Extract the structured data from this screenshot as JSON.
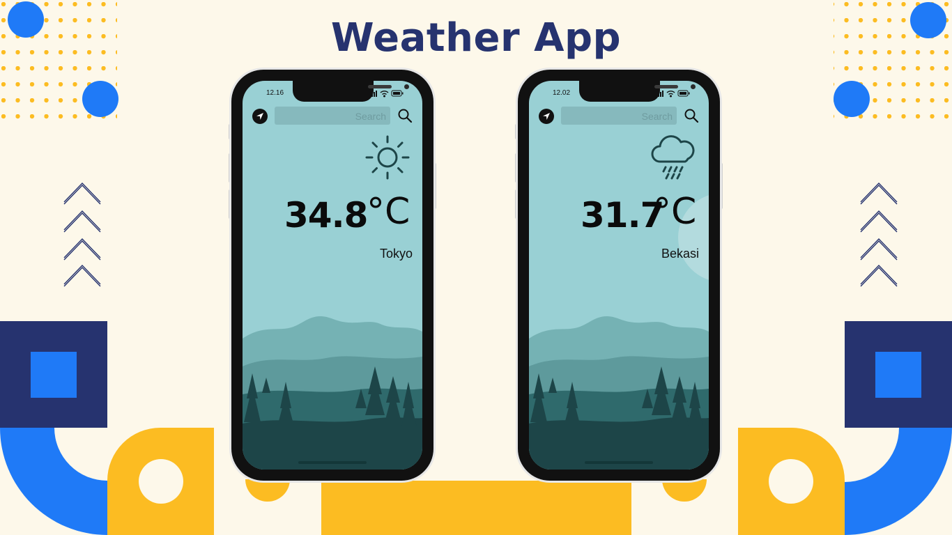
{
  "title": "Weather App",
  "phones": [
    {
      "time": "12.16",
      "search_placeholder": "Search",
      "temperature": "34.8",
      "unit": "°C",
      "city": "Tokyo",
      "condition_icon": "sun-icon"
    },
    {
      "time": "12.02",
      "search_placeholder": "Search",
      "temperature": "31.7",
      "unit": "°C",
      "city": "Bekasi",
      "condition_icon": "rain-cloud-icon"
    }
  ],
  "colors": {
    "background": "#fdf8ea",
    "navy": "#26336f",
    "blue": "#1f7af7",
    "yellow": "#fcbc22",
    "sky": "#99d0d4"
  }
}
